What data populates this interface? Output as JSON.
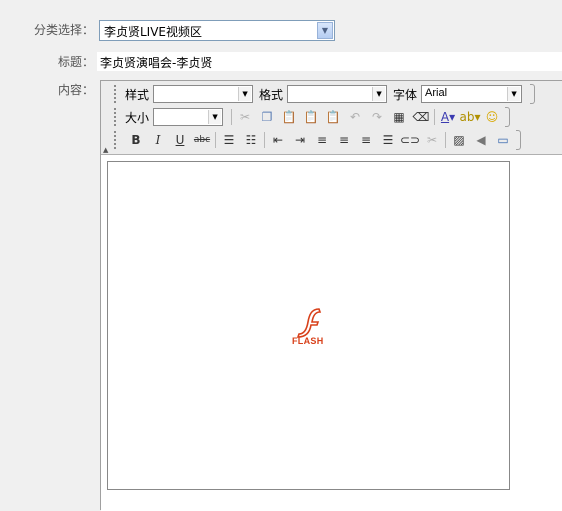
{
  "form": {
    "category_label": "分类选择：",
    "category_value": "李贞贤LIVE视频区",
    "title_label": "标题：",
    "title_value": "李贞贤演唱会-李贞贤",
    "content_label": "内容："
  },
  "toolbar": {
    "style_label": "样式",
    "format_label": "格式",
    "font_label": "字体",
    "font_value": "Arial",
    "size_label": "大小",
    "style_value": "",
    "format_value": "",
    "size_value": ""
  },
  "editor": {
    "flash_text": "FLASH",
    "flash_color": "#d8401a"
  }
}
